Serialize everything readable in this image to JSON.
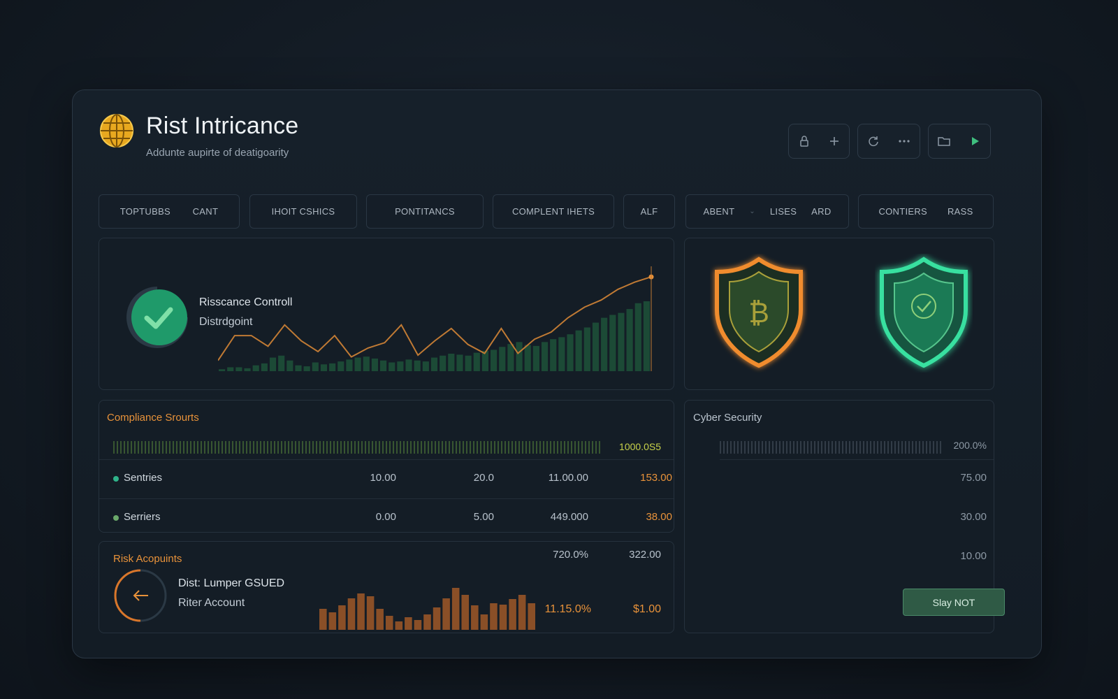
{
  "header": {
    "title": "Rist Intricance",
    "subtitle": "Addunte aupirte of deatigoarity"
  },
  "toolbar": {
    "groups": [
      [
        "lock-icon",
        "plus-icon"
      ],
      [
        "refresh-icon",
        "more-icon"
      ],
      [
        "folder-icon",
        "play-icon"
      ]
    ]
  },
  "tabs": [
    [
      "TOPTUBBS",
      "CANT"
    ],
    [
      "IHOIT CSHICS"
    ],
    [
      "PONTITANCS"
    ],
    [
      "COMPLENT IHETS"
    ],
    [
      "ALF"
    ],
    [
      "ABENT",
      "LISES",
      "ARD"
    ],
    [
      "CONTIERS",
      "RASS"
    ]
  ],
  "overview": {
    "line1": "Risscance Controll",
    "line2": "Distrdgoint",
    "status_icon": "check-icon",
    "chart_data": {
      "type": "bar",
      "bar_values": [
        2,
        4,
        4,
        3,
        6,
        8,
        14,
        16,
        11,
        6,
        5,
        9,
        7,
        8,
        10,
        12,
        14,
        15,
        13,
        11,
        9,
        10,
        12,
        11,
        10,
        14,
        16,
        18,
        17,
        16,
        19,
        21,
        22,
        25,
        28,
        30,
        27,
        26,
        30,
        33,
        35,
        38,
        42,
        45,
        50,
        55,
        58,
        60,
        64,
        70,
        72
      ]
    }
  },
  "shields": [
    {
      "name": "bitcoin-shield",
      "color": "#f08c2e",
      "symbol": "₿"
    },
    {
      "name": "secure-shield",
      "color": "#39e0a0",
      "symbol": "✓"
    }
  ],
  "compliance": {
    "title": "Compliance Srourts",
    "progress_label": "1000.0S5",
    "rows": [
      {
        "label": "Sentries",
        "dot": "#2fb38a",
        "values": [
          "10.00",
          "20.0",
          "11.00.00"
        ],
        "highlight": "153.00"
      },
      {
        "label": "Serriers",
        "dot": "#6aa86a",
        "values": [
          "0.00",
          "5.00",
          "449.000"
        ],
        "highlight": "38.00"
      }
    ]
  },
  "risk": {
    "title": "Risk Acopuints",
    "line1": "Dist: Lumper GSUED",
    "line2": "Riter Account",
    "stat1": "720.0%",
    "stat2": "322.00",
    "value1": "11.15.0%",
    "value2": "$1.00",
    "arrow_icon": "arrow-left-icon",
    "chart_data": {
      "type": "bar",
      "values": [
        30,
        25,
        35,
        45,
        52,
        48,
        30,
        20,
        12,
        18,
        14,
        22,
        32,
        45,
        60,
        50,
        35,
        22,
        38,
        36,
        44,
        50,
        38
      ]
    }
  },
  "cyber": {
    "title": "Cyber Security",
    "progress_label": "200.0%",
    "values": [
      "75.00",
      "30.00",
      "10.00"
    ],
    "button_label": "Slay NOT"
  },
  "colors": {
    "accent_green": "#2fb38a",
    "accent_orange": "#e8923a"
  }
}
